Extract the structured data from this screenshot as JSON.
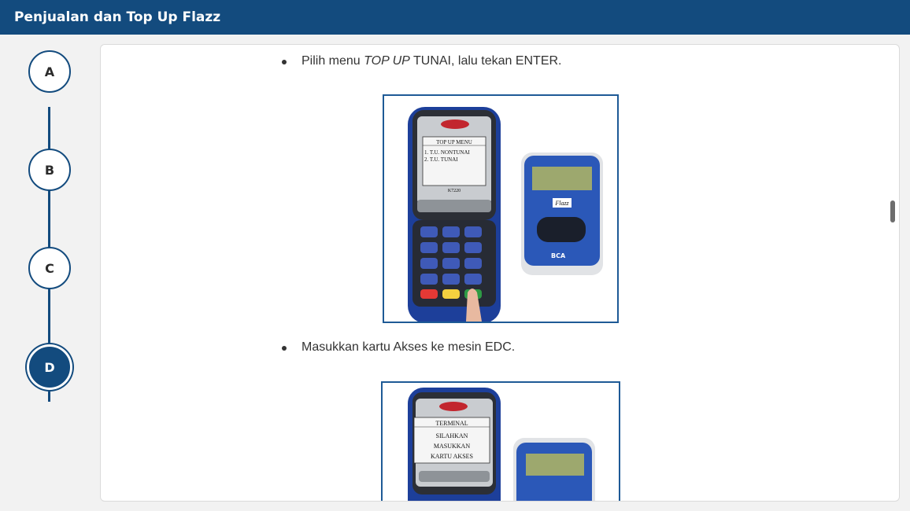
{
  "header": {
    "title": "Penjualan dan Top Up Flazz"
  },
  "steps": [
    {
      "label": "A",
      "active": false
    },
    {
      "label": "B",
      "active": false
    },
    {
      "label": "C",
      "active": false
    },
    {
      "label": "D",
      "active": true
    }
  ],
  "content": {
    "bullet1": {
      "prefix": "Pilih menu ",
      "emphasis": "TOP UP",
      "suffix": " TUNAI, lalu tekan ENTER."
    },
    "image1": {
      "screen_title": "TOP UP MENU",
      "option1": "1. T.U. NONTUNAI",
      "option2": "2. T.U. TUNAI",
      "device_model": "K7220",
      "card_reader_brand": "Flazz",
      "bank": "BCA"
    },
    "bullet2": {
      "text": "Masukkan kartu Akses ke mesin EDC."
    },
    "image2": {
      "screen_title": "TERMINAL",
      "line1": "SILAHKAN",
      "line2": "MASUKKAN",
      "line3": "KARTU AKSES"
    }
  },
  "colors": {
    "header": "#134b7e",
    "accent": "#134b7e"
  }
}
